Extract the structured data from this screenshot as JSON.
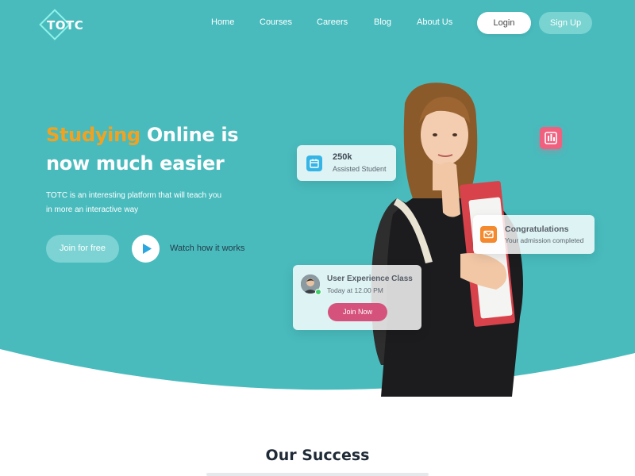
{
  "colors": {
    "teal": "#49bbbd",
    "accent_orange": "#f4a21e",
    "join_now_pink": "#d5527c",
    "badge_pink": "#f0607f",
    "student_icon_blue": "#35b5e5",
    "congrats_icon_orange": "#f4892e",
    "online_green": "#3fcf6b"
  },
  "header": {
    "logo": "TOTC",
    "nav": [
      "Home",
      "Courses",
      "Careers",
      "Blog",
      "About Us"
    ],
    "login_label": "Login",
    "signup_label": "Sign Up"
  },
  "hero": {
    "headline_accent": "Studying",
    "headline_rest": " Online is now much easier",
    "subtext": "TOTC is an interesting platform that will teach you in more an interactive way",
    "join_label": "Join for free",
    "watch_label": "Watch how it works"
  },
  "cards": {
    "students": {
      "icon": "calendar-icon",
      "value": "250k",
      "label": "Assisted Student"
    },
    "congrats": {
      "icon": "mail-icon",
      "title": "Congratulations",
      "text": "Your admission completed"
    },
    "class": {
      "title": "User Experience Class",
      "time": "Today at 12.00 PM",
      "button": "Join Now"
    },
    "badge_icon": "bar-chart-icon"
  },
  "success": {
    "title": "Our Success"
  }
}
